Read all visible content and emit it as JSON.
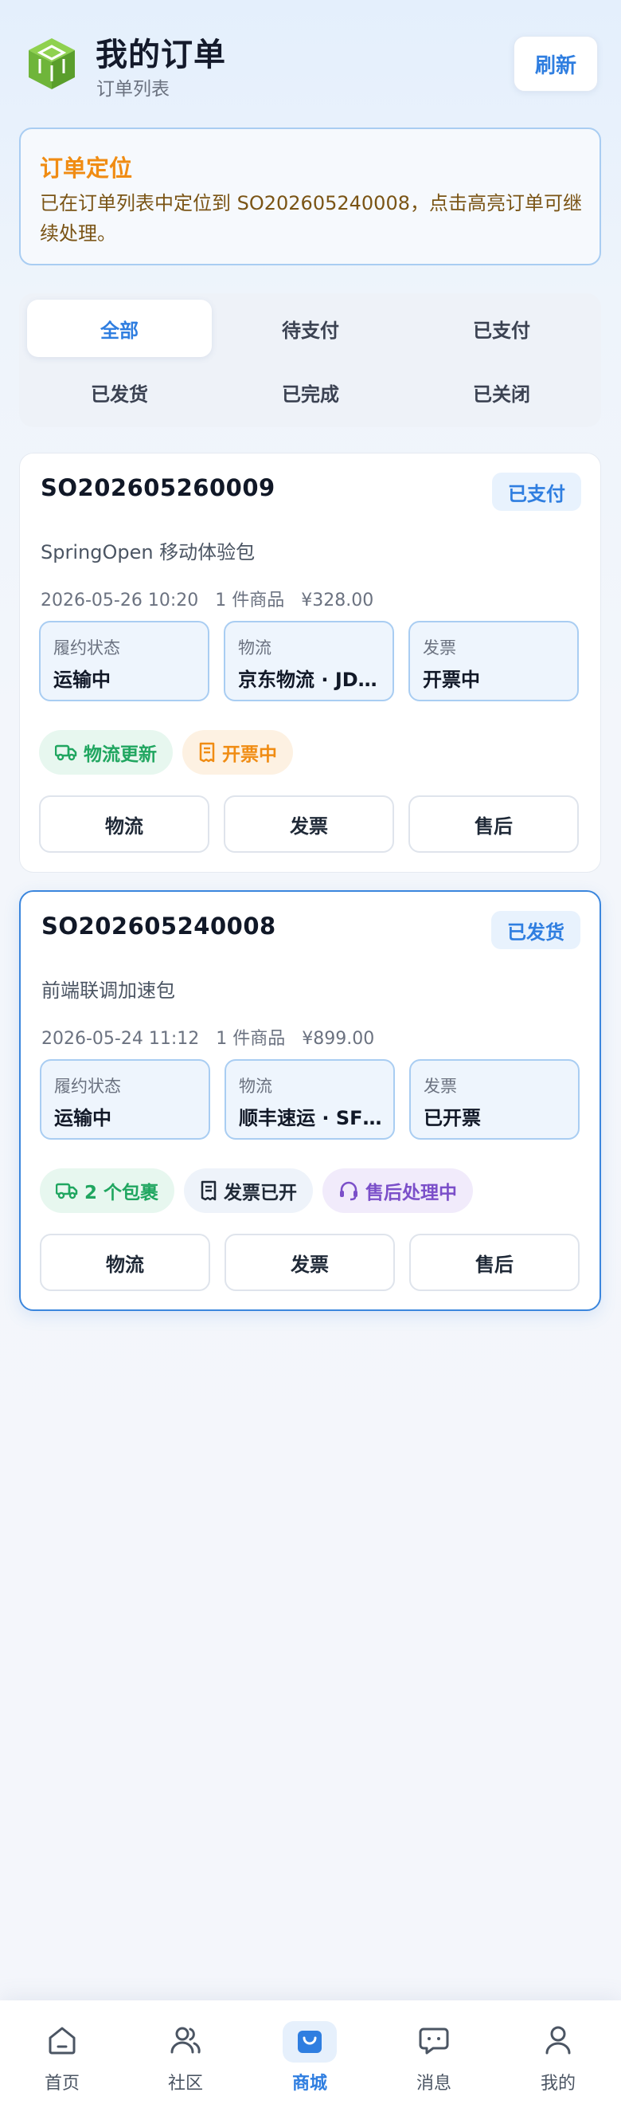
{
  "header": {
    "title": "我的订单",
    "subtitle": "订单列表",
    "refresh_label": "刷新"
  },
  "notice": {
    "title": "订单定位",
    "text": "已在订单列表中定位到 SO202605240008，点击高亮订单可继续处理。"
  },
  "tabs": [
    {
      "label": "全部",
      "active": true
    },
    {
      "label": "待支付"
    },
    {
      "label": "已支付"
    },
    {
      "label": "已发货"
    },
    {
      "label": "已完成"
    },
    {
      "label": "已关闭"
    }
  ],
  "orders": [
    {
      "order_no": "SO202605260009",
      "status": "已支付",
      "product": "SpringOpen 移动体验包",
      "time": "2026-05-26 10:20",
      "count": "1 件商品",
      "amount": "¥328.00",
      "info": [
        {
          "label": "履约状态",
          "value": "运输中"
        },
        {
          "label": "物流",
          "value": "京东物流 · JD…"
        },
        {
          "label": "发票",
          "value": "开票中"
        }
      ],
      "chips": [
        {
          "label": "物流更新",
          "icon": "truck-icon",
          "color": "#20a660"
        },
        {
          "label": "开票中",
          "icon": "receipt-icon",
          "color": "#f08c13"
        }
      ],
      "actions": [
        "物流",
        "发票",
        "售后"
      ]
    },
    {
      "order_no": "SO202605240008",
      "status": "已发货",
      "product": "前端联调加速包",
      "time": "2026-05-24 11:12",
      "count": "1 件商品",
      "amount": "¥899.00",
      "info": [
        {
          "label": "履约状态",
          "value": "运输中"
        },
        {
          "label": "物流",
          "value": "顺丰速运 · SF…"
        },
        {
          "label": "发票",
          "value": "已开票"
        }
      ],
      "chips": [
        {
          "label": "2 个包裹",
          "icon": "truck-icon",
          "color": "#20a660"
        },
        {
          "label": "发票已开",
          "icon": "receipt-icon",
          "color": "#1f2937"
        },
        {
          "label": "售后处理中",
          "icon": "headset-icon",
          "color": "#7b4fc9"
        }
      ],
      "actions": [
        "物流",
        "发票",
        "售后"
      ]
    }
  ],
  "bottom_nav": [
    {
      "label": "首页",
      "icon": "home-icon"
    },
    {
      "label": "社区",
      "icon": "users-icon"
    },
    {
      "label": "商城",
      "icon": "shopping-bag-icon",
      "active": true
    },
    {
      "label": "消息",
      "icon": "message-icon"
    },
    {
      "label": "我的",
      "icon": "user-icon"
    }
  ],
  "colors": {
    "accent": "#2f7ee0",
    "notice_title": "#f08c13",
    "highlight_border": "#3b86dd"
  }
}
